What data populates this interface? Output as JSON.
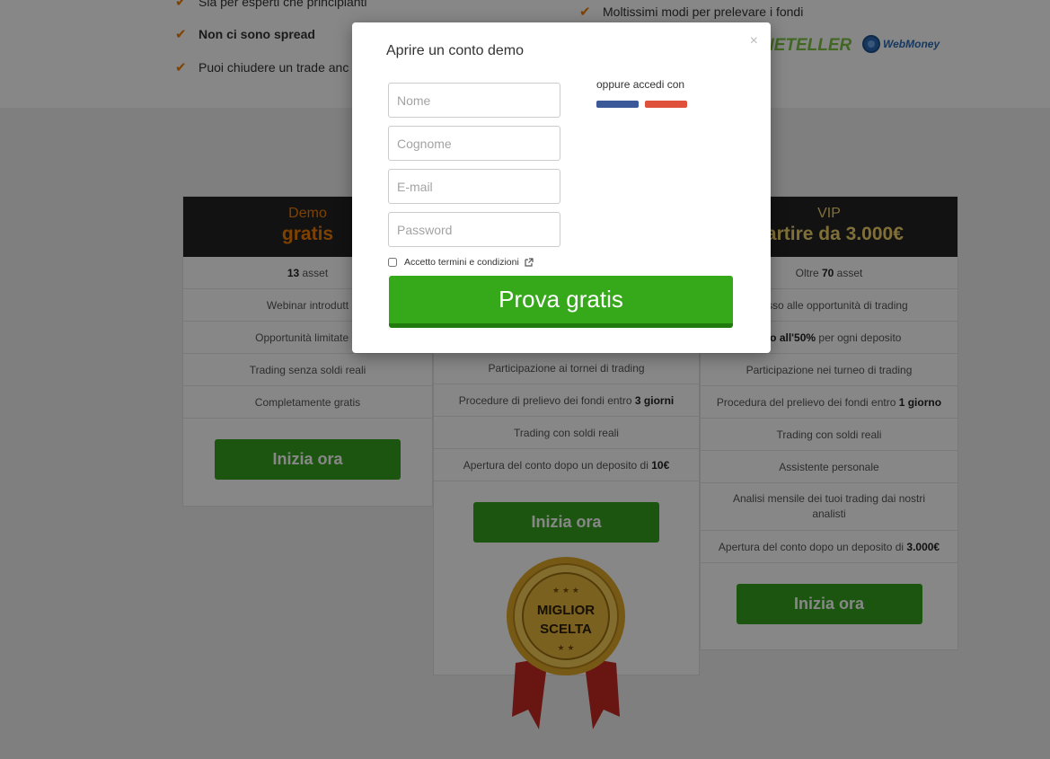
{
  "features_left": [
    {
      "label": "Sia per esperti che principianti",
      "bold": false
    },
    {
      "label": "Non ci sono spread",
      "bold": true
    },
    {
      "label": "Puoi chiudere un trade anc",
      "bold": false
    }
  ],
  "features_right": [
    {
      "label": "Moltissimi modi per prelevare i fondi"
    }
  ],
  "payment_logos": [
    "NETELLER",
    "WebMoney"
  ],
  "plans": [
    {
      "plan": "Demo",
      "price": "gratis",
      "plan_color": "#f07c00",
      "rows": [
        {
          "pre": "",
          "b": "13",
          "post": " asset"
        },
        {
          "pre": "Webinar introdutt",
          "b": "",
          "post": ""
        },
        {
          "pre": "Opportunità limitate di",
          "b": "",
          "post": ""
        },
        {
          "pre": "Trading senza soldi reali",
          "b": "",
          "post": ""
        },
        {
          "pre": "Completamente gratis",
          "b": "",
          "post": ""
        }
      ],
      "button": "Inizia ora"
    },
    {
      "plan": "",
      "price": "",
      "rows": [
        {
          "pre": "Participazione ai tornei di trading",
          "b": "",
          "post": ""
        },
        {
          "pre": "Procedure di prelievo dei fondi entro ",
          "b": "3 giorni",
          "post": ""
        },
        {
          "pre": "Trading con soldi reali",
          "b": "",
          "post": ""
        },
        {
          "pre": "Apertura del conto dopo un deposito di ",
          "b": "10€",
          "post": ""
        }
      ],
      "button": "Inizia ora"
    },
    {
      "plan": "VIP",
      "price": "partire da 3.000€",
      "plan_color": "#f2d36b",
      "rows": [
        {
          "pre": "Oltre ",
          "b": "70",
          "post": " asset"
        },
        {
          "pre": "ccesso alle opportunità di trading",
          "b": "",
          "post": ""
        },
        {
          "pre": "",
          "b": "fino all'50%",
          "post": " per ogni deposito"
        },
        {
          "pre": "Participazione nei turneo di trading",
          "b": "",
          "post": ""
        },
        {
          "pre": "Procedura del prelievo dei fondi entro ",
          "b": "1 giorno",
          "post": ""
        },
        {
          "pre": "Trading con soldi reali",
          "b": "",
          "post": ""
        },
        {
          "pre": "Assistente personale",
          "b": "",
          "post": ""
        },
        {
          "pre": "Analisi mensile dei tuoi trading dai nostri analisti",
          "b": "",
          "post": "",
          "tall": true
        },
        {
          "pre": "Apertura del conto dopo un deposito di ",
          "b": "3.000€",
          "post": ""
        }
      ],
      "button": "Inizia ora"
    }
  ],
  "badge": {
    "line1": "MIGLIOR",
    "line2": "SCELTA"
  },
  "modal": {
    "title": "Aprire un conto demo",
    "close": "×",
    "fields": {
      "first_name": {
        "placeholder": "Nome",
        "value": ""
      },
      "last_name": {
        "placeholder": "Cognome",
        "value": ""
      },
      "email": {
        "placeholder": "E-mail",
        "value": ""
      },
      "password": {
        "placeholder": "Password",
        "value": ""
      }
    },
    "social_label": "oppure accedi con",
    "terms_label": "Accetto termini e condizioni",
    "submit_label": "Prova gratis"
  },
  "colors": {
    "accent_orange": "#f07c00",
    "button_green": "#36a01d",
    "submit_green": "#35a91a",
    "facebook": "#3b5998",
    "google": "#e0513c"
  }
}
